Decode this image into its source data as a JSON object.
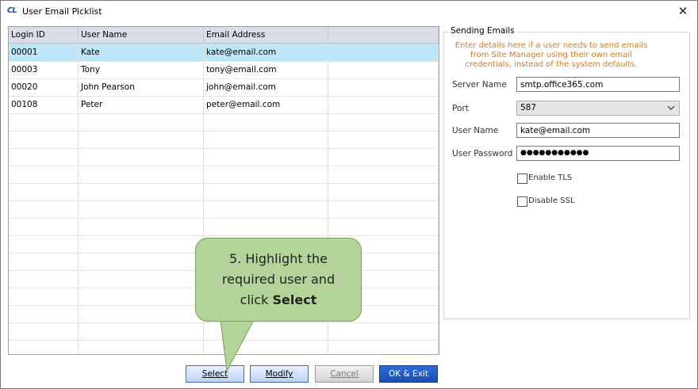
{
  "window": {
    "logo": "CL",
    "title": "User Email Picklist",
    "close_glyph": "✕"
  },
  "grid": {
    "columns": [
      "Login ID",
      "User Name",
      "Email Address",
      ""
    ],
    "rows": [
      {
        "login_id": "00001",
        "user_name": "Kate",
        "email": "kate@email.com",
        "selected": true
      },
      {
        "login_id": "00003",
        "user_name": "Tony",
        "email": "tony@email.com",
        "selected": false
      },
      {
        "login_id": "00020",
        "user_name": "John Pearson",
        "email": "john@email.com",
        "selected": false
      },
      {
        "login_id": "00108",
        "user_name": "Peter",
        "email": "peter@email.com",
        "selected": false
      }
    ],
    "empty_row_count": 14
  },
  "sending": {
    "title": "Sending Emails",
    "note": "Enter details here if a user needs to send emails from Site Manager using their own email credentials, instead of the system defaults.",
    "server_label": "Server Name",
    "server_value": "smtp.office365.com",
    "port_label": "Port",
    "port_value": "587",
    "username_label": "User Name",
    "username_value": "kate@email.com",
    "password_label": "User Password",
    "password_value": "●●●●●●●●●●●",
    "tls_label": "Enable TLS",
    "ssl_label": "Disable SSL"
  },
  "buttons": {
    "select_label": "Select",
    "modify_label": "Modify",
    "cancel_label": "Cancel",
    "ok_label": "OK & Exit"
  },
  "callout": {
    "line1": "5. Highlight the",
    "line2": "required user and",
    "line3_prefix": "click ",
    "line3_bold": "Select"
  },
  "colors": {
    "selected_row": "#bfe6f7",
    "note_text": "#e07818",
    "callout_fill": "#b3d39b",
    "primary_button": "#1c4eb3"
  },
  "icons": [
    "app-logo-icon",
    "close-icon",
    "chevron-down-icon"
  ]
}
